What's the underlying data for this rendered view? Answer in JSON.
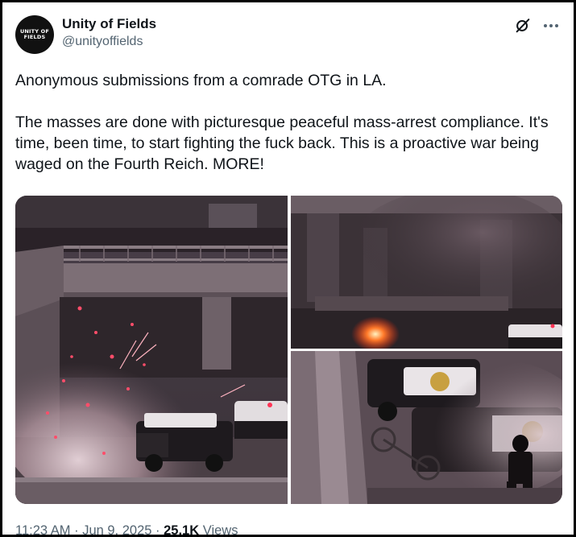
{
  "author": {
    "avatar_text": "UNITY OF FIELDS",
    "display_name": "Unity of Fields",
    "handle": "@unityoffields"
  },
  "icons": {
    "grok": "grok-icon",
    "more": "more-icon"
  },
  "tweet": {
    "paragraph_1": "Anonymous submissions from a comrade OTG in LA.",
    "paragraph_2": "The masses are done with picturesque peaceful mass-arrest compliance. It's time, been time, to start fighting the fuck back. This is a proactive war being waged on the Fourth Reich. MORE!"
  },
  "meta": {
    "time": "11:23 AM",
    "separator": "·",
    "date": "Jun 9, 2025",
    "views_count": "25.1K",
    "views_label": "Views"
  }
}
